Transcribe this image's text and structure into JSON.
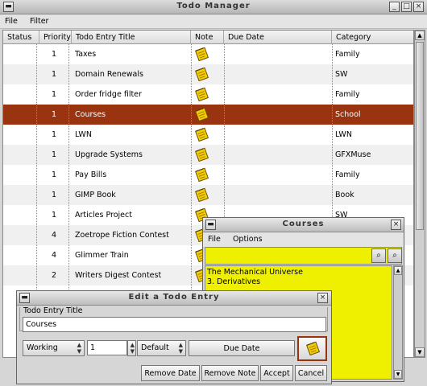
{
  "window": {
    "title": "Todo Manager"
  },
  "menu": [
    "File",
    "Filter"
  ],
  "columns": [
    "Status",
    "Priority",
    "Todo Entry Title",
    "Note",
    "Due Date",
    "Category"
  ],
  "rows": [
    {
      "priority": "1",
      "title": "Taxes",
      "category": "Family"
    },
    {
      "priority": "1",
      "title": "Domain Renewals",
      "category": "SW"
    },
    {
      "priority": "1",
      "title": "Order fridge filter",
      "category": "Family"
    },
    {
      "priority": "1",
      "title": "Courses",
      "category": "School",
      "selected": true
    },
    {
      "priority": "1",
      "title": "LWN",
      "category": "LWN"
    },
    {
      "priority": "1",
      "title": "Upgrade Systems",
      "category": "GFXMuse"
    },
    {
      "priority": "1",
      "title": "Pay Bills",
      "category": "Family"
    },
    {
      "priority": "1",
      "title": "GIMP Book",
      "category": "Book"
    },
    {
      "priority": "1",
      "title": "Articles Project",
      "category": "SW"
    },
    {
      "priority": "4",
      "title": "Zoetrope Fiction Contest",
      "category": ""
    },
    {
      "priority": "4",
      "title": "Glimmer Train",
      "category": ""
    },
    {
      "priority": "2",
      "title": "Writers Digest Contest",
      "category": ""
    }
  ],
  "note_window": {
    "title": "Courses",
    "menu": [
      "File",
      "Options"
    ],
    "lines": [
      "The Mechanical Universe",
      "3. Derivatives"
    ],
    "bg_color": "#efef00"
  },
  "edit_window": {
    "title": "Edit a Todo Entry",
    "title_label": "Todo Entry Title",
    "title_value": "Courses",
    "status": "Working",
    "priority": "1",
    "category": "Default",
    "due_date_button": "Due Date",
    "buttons": [
      "Remove Date",
      "Remove Note",
      "Accept",
      "Cancel"
    ]
  },
  "colors": {
    "selection": "#9a3410",
    "note": "#efef00"
  }
}
